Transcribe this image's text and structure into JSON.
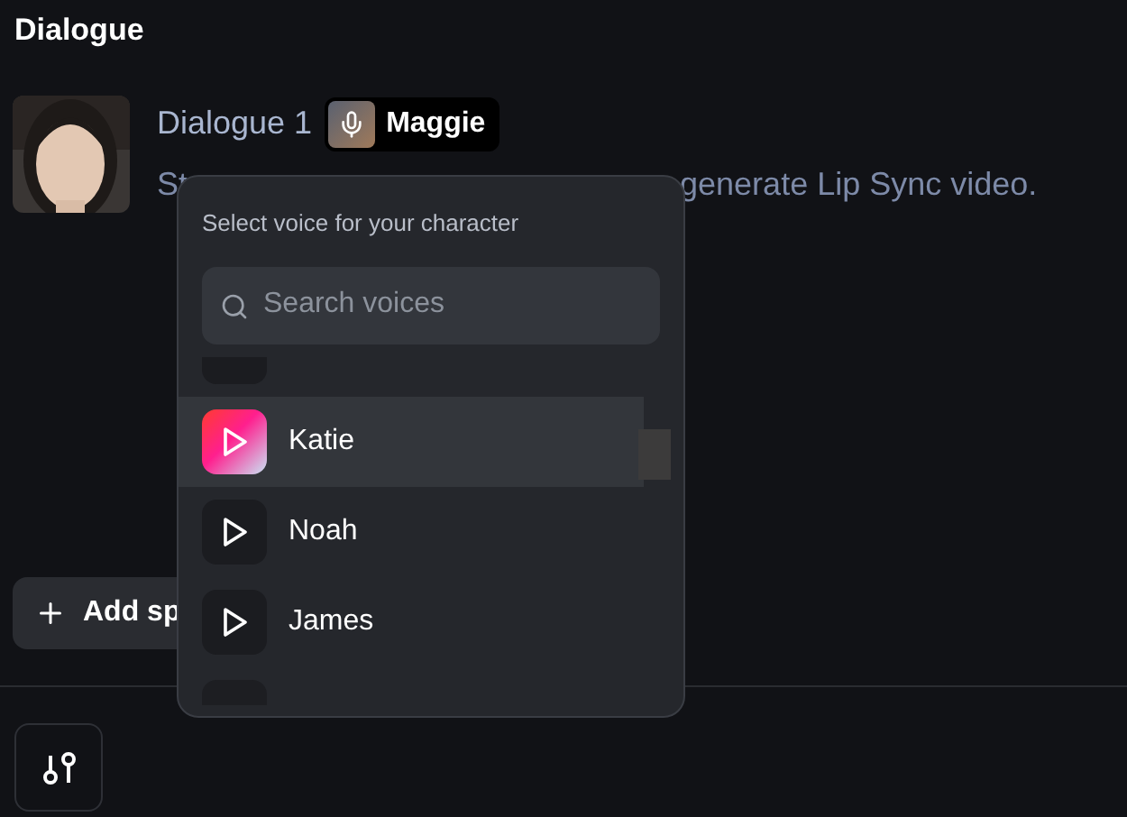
{
  "title": "Dialogue",
  "dialogue": {
    "name": "Dialogue 1",
    "voice": "Maggie",
    "hint_before": "St",
    "hint_after": "generate Lip Sync video."
  },
  "add_button": {
    "label": "Add sp"
  },
  "voice_popup": {
    "heading": "Select voice for your character",
    "search": {
      "placeholder": "Search voices"
    },
    "voices": [
      {
        "name": "Katie",
        "selected": true
      },
      {
        "name": "Noah",
        "selected": false
      },
      {
        "name": "James",
        "selected": false
      }
    ]
  }
}
